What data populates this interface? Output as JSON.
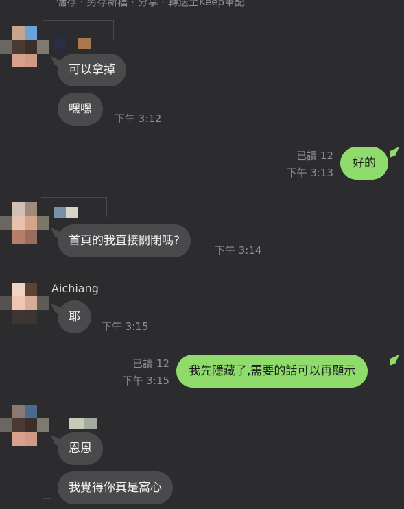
{
  "top_fragment": "儲存 · 另存新檔 · 分享 · 轉送至Keep筆記",
  "messages": [
    {
      "text": "可以拿掉"
    },
    {
      "text": "嘿嘿",
      "time": "下午 3:12"
    },
    {
      "text": "好的",
      "read": "已讀 12",
      "time": "下午 3:13"
    },
    {
      "text": "首頁的我直接關閉嗎?",
      "time": "下午 3:14"
    },
    {
      "sender": "Aichiang",
      "text": "耶",
      "time": "下午 3:15"
    },
    {
      "text": "我先隱藏了,需要的話可以再顯示",
      "read": "已讀 12",
      "time": "下午 3:15"
    },
    {
      "text": "恩恩"
    },
    {
      "text": "我覺得你真是窩心"
    }
  ],
  "colors": {
    "background": "#2c2c2e",
    "incoming_bubble": "#4a4a4d",
    "outgoing_bubble": "#8fdb6c",
    "meta_text": "#8e8e90"
  }
}
